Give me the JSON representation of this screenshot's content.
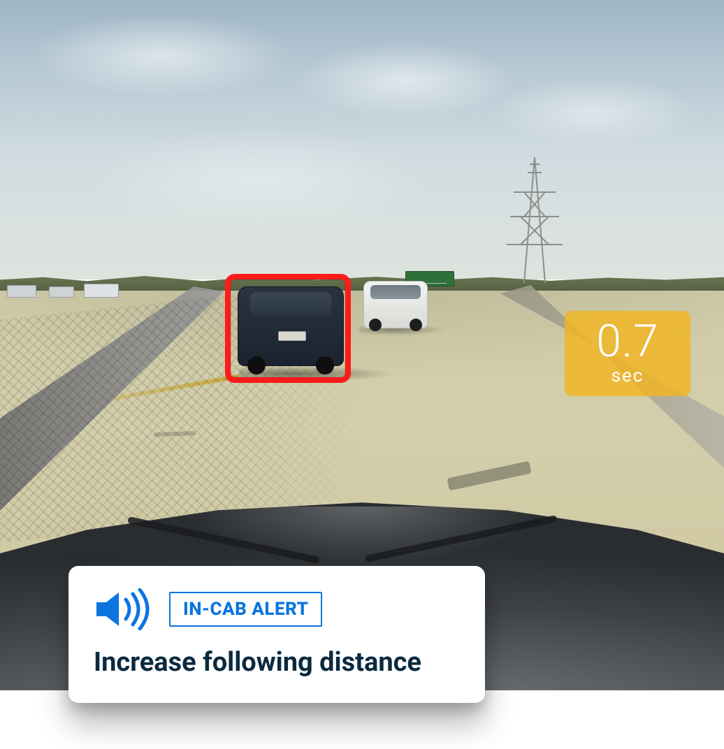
{
  "overlay": {
    "following_time_value": "0.7",
    "following_time_unit": "sec"
  },
  "alert": {
    "badge_label": "IN-CAB ALERT",
    "message": "Increase following distance"
  },
  "icons": {
    "speaker": "speaker-icon"
  },
  "colors": {
    "accent_blue": "#0b74de",
    "badge_amber": "#f1b420",
    "track_red": "#ff1a1a",
    "text_dark": "#0b2a3f"
  }
}
